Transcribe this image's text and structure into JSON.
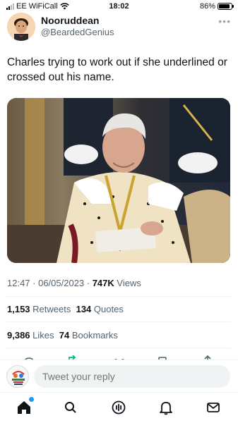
{
  "status_bar": {
    "carrier": "EE WiFiCall",
    "time": "18:02",
    "battery": "86%",
    "battery_level": 0.86,
    "icons": [
      "signal-icon",
      "wifi-icon",
      "battery-icon"
    ]
  },
  "tweet": {
    "author_name": "Nooruddean",
    "author_handle": "@BeardedGenius",
    "text": "Charles trying to work out if she underlined or crossed out his name.",
    "media_icon": "photo-image",
    "timestamp": "12:47 · 06/05/2023 · ",
    "views_count": "747K",
    "views_label": " Views",
    "retweets_count": "1,153",
    "retweets_label": " Retweets",
    "quotes_count": "134",
    "quotes_label": " Quotes",
    "likes_count": "9,386",
    "likes_label": " Likes",
    "bookmarks_count": "74",
    "bookmarks_label": " Bookmarks"
  },
  "actions": [
    "reply-icon",
    "retweet-icon",
    "like-icon",
    "bookmark-icon",
    "share-icon"
  ],
  "reply": {
    "placeholder": "Tweet your reply"
  },
  "tabbar": {
    "items": [
      "home-icon",
      "search-icon",
      "spaces-icon",
      "notifications-icon",
      "messages-icon"
    ],
    "active": "home-icon",
    "notification_dot_color": "#1d9bf0"
  },
  "colors": {
    "text": "#0f1419",
    "secondary": "#536471",
    "accent": "#1d9bf0",
    "divider": "#eff3f4"
  }
}
